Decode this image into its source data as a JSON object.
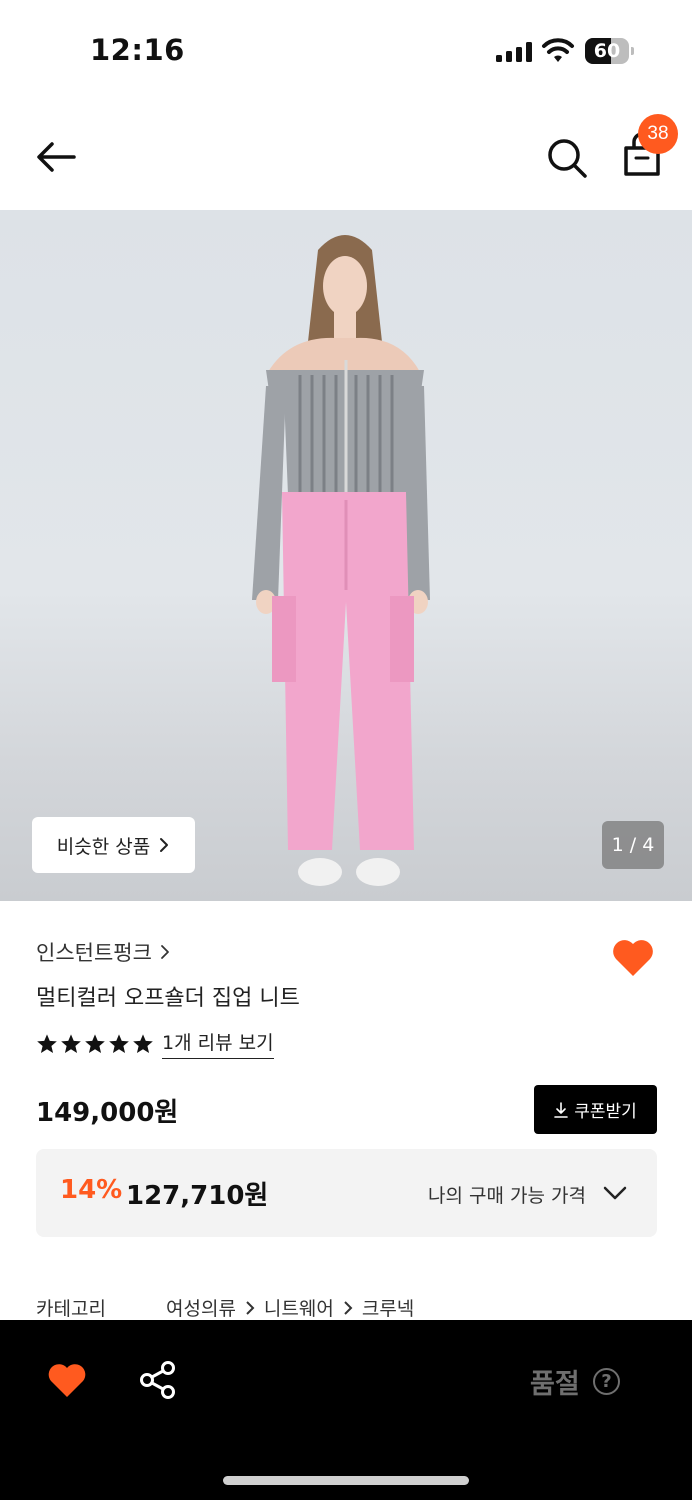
{
  "status_bar": {
    "time": "12:16",
    "battery": "60",
    "battery_level": 0.6
  },
  "header": {
    "cart_count": "38",
    "icons": [
      "arrow-left-icon",
      "search-icon",
      "shopping-bag-icon"
    ]
  },
  "hero": {
    "similar_button_label": "비슷한 상품",
    "page_indicator": "1 / 4",
    "colors": {
      "top": "#9a9ea3",
      "pants": "#f2a6cc",
      "background": "#dde2e7"
    }
  },
  "product": {
    "brand": "인스턴트펑크",
    "name": "멀티컬러 오프숄더 집업 니트",
    "rating": 5,
    "review_link": "1개 리뷰 보기",
    "liked": true
  },
  "pricing": {
    "price": "149,000원",
    "coupon_label": "쿠폰받기",
    "discount_rate": "14%",
    "discount_price": "127,710원",
    "my_price_label": "나의 구매 가능 가격"
  },
  "category": {
    "label": "카테고리",
    "path": [
      "여성의류",
      "니트웨어",
      "크루넥"
    ]
  },
  "bottom_bar": {
    "status": "품절",
    "help": "?"
  },
  "colors": {
    "accent": "#ff5a1f",
    "black": "#000000"
  }
}
